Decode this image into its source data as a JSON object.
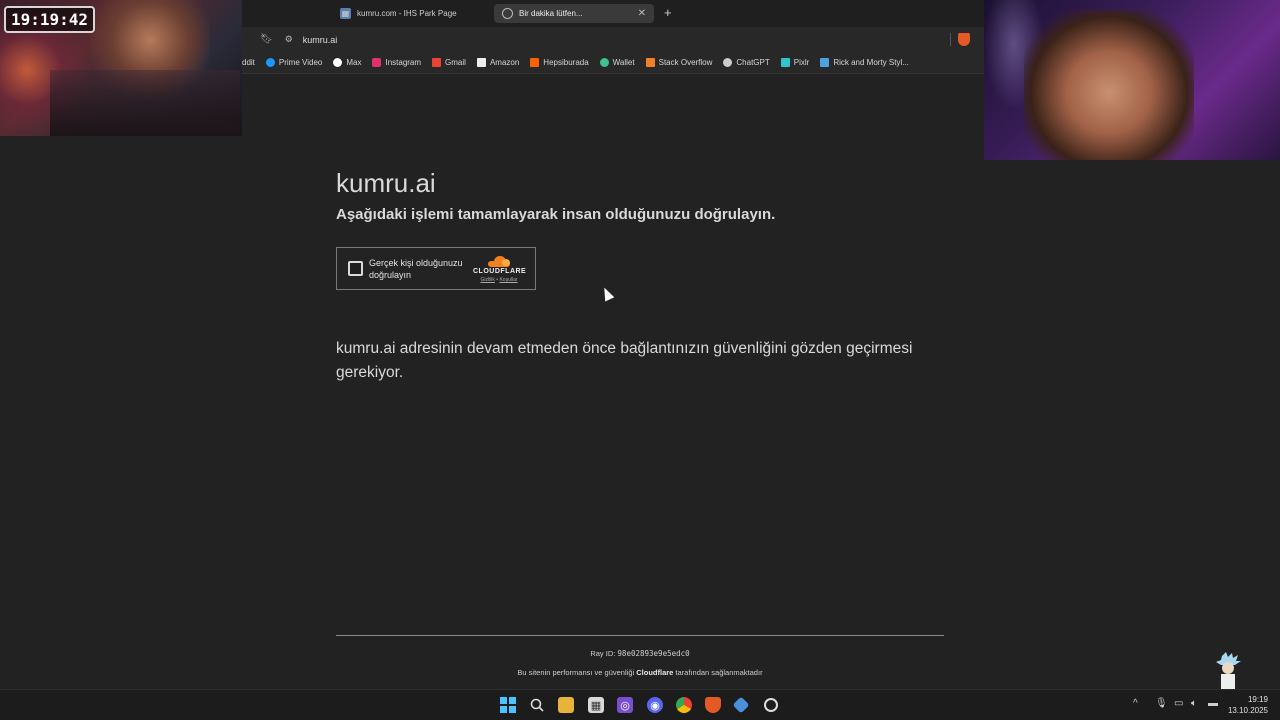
{
  "overlay": {
    "clock": "19:19:42"
  },
  "browser": {
    "tabs": [
      {
        "title": "kumru.com - IHS Park Page",
        "active": false
      },
      {
        "title": "Bir dakika lütfen...",
        "active": true
      }
    ],
    "address": "kumru.ai",
    "bookmarks": [
      {
        "label": "ddit",
        "color": "#ff4500"
      },
      {
        "label": "Prime Video",
        "color": "#1a98ff"
      },
      {
        "label": "Max",
        "color": "#ffffff"
      },
      {
        "label": "Instagram",
        "color": "#e1306c"
      },
      {
        "label": "Gmail",
        "color": "#ea4335"
      },
      {
        "label": "Amazon",
        "color": "#eeeeee"
      },
      {
        "label": "Hepsiburada",
        "color": "#ff6000"
      },
      {
        "label": "Wallet",
        "color": "#3ec28f"
      },
      {
        "label": "Stack Overflow",
        "color": "#f48024"
      },
      {
        "label": "ChatGPT",
        "color": "#cccccc"
      },
      {
        "label": "Pixlr",
        "color": "#2ec5ce"
      },
      {
        "label": "Rick and Morty Styl...",
        "color": "#4aa3df"
      }
    ]
  },
  "page": {
    "title": "kumru.ai",
    "subtitle": "Aşağıdaki işlemi tamamlayarak insan olduğunuzu doğrulayın.",
    "challenge": {
      "label": "Gerçek kişi olduğunuzu doğrulayın",
      "brand": "CLOUDFLARE",
      "privacy": "Gizlilik",
      "terms": "Koşullar"
    },
    "body": "kumru.ai adresinin devam etmeden önce bağlantınızın güvenliğini gözden geçirmesi gerekiyor.",
    "ray_label": "Ray ID: ",
    "ray_id": "98e02893e9e5edc0",
    "perf_prefix": "Bu sitenin performansı ve güvenliği ",
    "perf_brand": "Cloudflare",
    "perf_suffix": " tarafından sağlanmaktadır"
  },
  "taskbar": {
    "time": "19:19",
    "date": "13.10.2025",
    "colors": {
      "start": "#4cc2ff",
      "brave": "#e35a26",
      "chrome": "#34a853"
    }
  }
}
